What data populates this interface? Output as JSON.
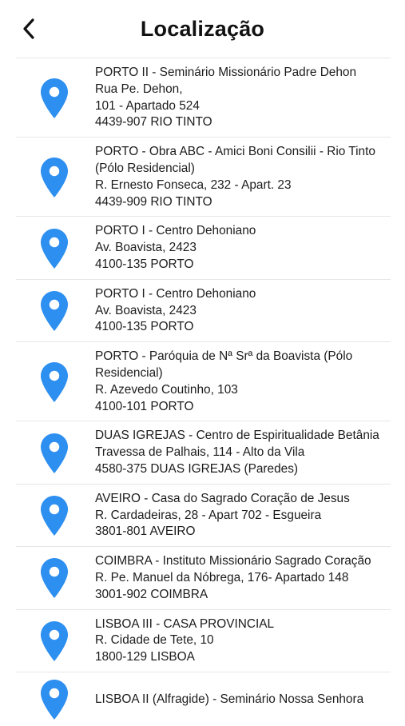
{
  "header": {
    "title": "Localização",
    "back_icon": "chevron-left-icon"
  },
  "colors": {
    "pin": "#2d8ff0",
    "divider": "#e6e6e6",
    "text": "#1c1c1c"
  },
  "locations": [
    {
      "name": "PORTO II - Seminário Missionário Padre Dehon",
      "address_lines": [
        "Rua Pe. Dehon,",
        "101 - Apartado 524",
        "4439-907 RIO TINTO"
      ]
    },
    {
      "name": "PORTO - Obra ABC - Amici Boni Consilii - Rio Tinto (Pólo Residencial)",
      "address_lines": [
        "R. Ernesto Fonseca, 232 - Apart. 23",
        "4439-909 RIO TINTO"
      ]
    },
    {
      "name": "PORTO I - Centro Dehoniano",
      "address_lines": [
        "Av. Boavista, 2423",
        "4100-135 PORTO"
      ]
    },
    {
      "name": "PORTO I - Centro Dehoniano",
      "address_lines": [
        "Av. Boavista, 2423",
        "4100-135 PORTO"
      ]
    },
    {
      "name": "PORTO - Paróquia de Nª Srª da Boavista (Pólo Residencial)",
      "address_lines": [
        "R. Azevedo Coutinho, 103",
        "4100-101 PORTO"
      ]
    },
    {
      "name": "DUAS IGREJAS - Centro de Espiritualidade Betânia",
      "address_lines": [
        "Travessa de Palhais, 114 - Alto da Vila",
        "4580-375 DUAS IGREJAS (Paredes)"
      ]
    },
    {
      "name": "AVEIRO - Casa do Sagrado Coração de Jesus",
      "address_lines": [
        "R. Cardadeiras, 28 - Apart 702 - Esgueira",
        "3801-801 AVEIRO"
      ]
    },
    {
      "name": "COIMBRA - Instituto Missionário Sagrado Coração",
      "address_lines": [
        "R. Pe. Manuel da Nóbrega, 176- Apartado 148",
        "3001-902 COIMBRA"
      ]
    },
    {
      "name": "LISBOA III - CASA PROVINCIAL",
      "address_lines": [
        "R. Cidade de Tete, 10",
        "1800-129 LISBOA"
      ]
    },
    {
      "name": "LISBOA II (Alfragide) - Seminário Nossa Senhora",
      "address_lines": []
    }
  ]
}
